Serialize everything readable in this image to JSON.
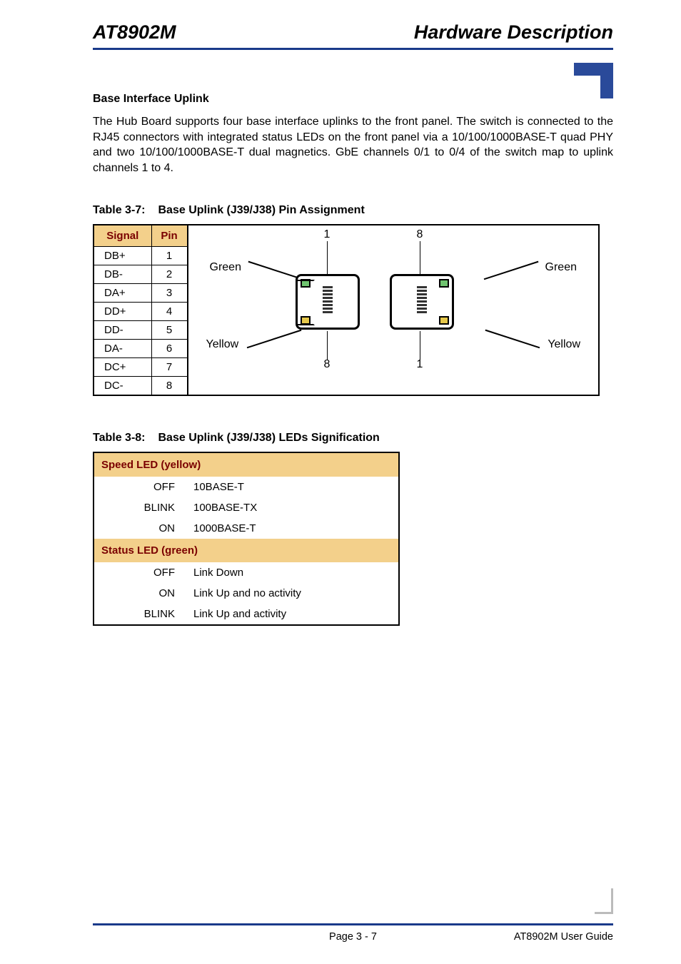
{
  "header": {
    "left": "AT8902M",
    "right": "Hardware Description"
  },
  "section_heading": "Base Interface Uplink",
  "body_paragraph": "The Hub Board supports four base interface uplinks to the front panel. The switch is connected to the RJ45 connectors with integrated status LEDs on the front panel via a 10/100/1000BASE-T quad PHY and two 10/100/1000BASE-T dual magnetics. GbE channels 0/1 to 0/4 of the switch map to uplink channels 1 to  4.",
  "table37": {
    "caption_num": "Table 3-7:",
    "caption_title": "Base Uplink (J39/J38) Pin Assignment",
    "headers": {
      "signal": "Signal",
      "pin": "Pin"
    },
    "rows": [
      {
        "signal": "DB+",
        "pin": "1"
      },
      {
        "signal": "DB-",
        "pin": "2"
      },
      {
        "signal": "DA+",
        "pin": "3"
      },
      {
        "signal": "DD+",
        "pin": "4"
      },
      {
        "signal": "DD-",
        "pin": "5"
      },
      {
        "signal": "DA-",
        "pin": "6"
      },
      {
        "signal": "DC+",
        "pin": "7"
      },
      {
        "signal": "DC-",
        "pin": "8"
      }
    ]
  },
  "diagram": {
    "top_left_num": "1",
    "top_right_num": "8",
    "bottom_left_num": "8",
    "bottom_right_num": "1",
    "green": "Green",
    "yellow": "Yellow"
  },
  "table38": {
    "caption_num": "Table 3-8:",
    "caption_title": "Base Uplink (J39/J38) LEDs Signification",
    "speed_header": "Speed LED (yellow)",
    "status_header": "Status LED (green)",
    "speed_rows": [
      {
        "state": "OFF",
        "meaning": "10BASE-T"
      },
      {
        "state": "BLINK",
        "meaning": "100BASE-TX"
      },
      {
        "state": "ON",
        "meaning": "1000BASE-T"
      }
    ],
    "status_rows": [
      {
        "state": "OFF",
        "meaning": "Link Down"
      },
      {
        "state": "ON",
        "meaning": "Link Up and no activity"
      },
      {
        "state": "BLINK",
        "meaning": "Link Up and activity"
      }
    ]
  },
  "footer": {
    "page": "Page 3 - 7",
    "guide": "AT8902M User Guide"
  }
}
